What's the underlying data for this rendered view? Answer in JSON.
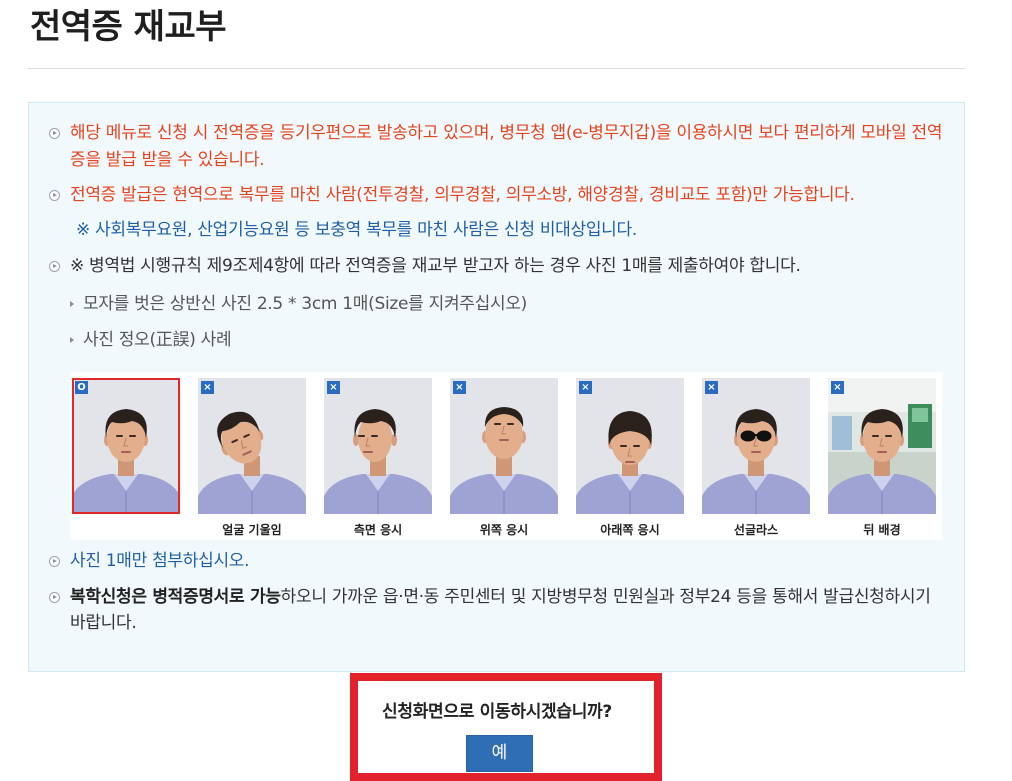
{
  "page": {
    "title": "전역증 재교부"
  },
  "notice": {
    "mobile_notice": "해당 메뉴로 신청 시 전역증을 등기우편으로 발송하고 있으며, 병무청 앱(e-병무지갑)을 이용하시면 보다 편리하게 모바일 전역증을 발급 받을 수 있습니다.",
    "eligibility": "전역증 발급은 현역으로 복무를 마친 사람(전투경찰, 의무경찰, 의무소방, 해양경찰, 경비교도 포함)만 가능합니다.",
    "ineligible_note": "※ 사회복무요원, 산업기능요원 등 보충역 복무를 마친 사람은 신청 비대상입니다.",
    "photo_requirement": "※ 병역법 시행규칙 제9조제4항에 따라 전역증을 재교부 받고자 하는 경우 사진 1매를 제출하여야 합니다.",
    "photo_specs": [
      "모자를 벗은 상반신 사진 2.5 * 3cm 1매(Size를 지켜주십시오)",
      "사진 정오(正誤) 사례"
    ],
    "attach_note": "사진 1매만 첨부하십시오.",
    "readmission_bold": "복학신청은 병적증명서로 가능",
    "readmission_rest": "하오니 가까운 읍·면·동 주민센터 및 지방병무청 민원실과 정부24 등을 통해서 발급신청하시기 바랍니다."
  },
  "photo_examples": [
    {
      "badge": "O",
      "label": ""
    },
    {
      "badge": "×",
      "label": "얼굴 기울임"
    },
    {
      "badge": "×",
      "label": "측면 응시"
    },
    {
      "badge": "×",
      "label": "위쪽 응시"
    },
    {
      "badge": "×",
      "label": "아래쪽 응시"
    },
    {
      "badge": "×",
      "label": "선글라스"
    },
    {
      "badge": "×",
      "label": "뒤 배경"
    }
  ],
  "dialog": {
    "message": "신청화면으로 이동하시겠습니까?",
    "confirm_label": "예"
  },
  "icons": {
    "bullet": "circle-arrow-icon",
    "sub_bullet": "chevron-right-icon",
    "correct_badge": "correct-badge-icon",
    "incorrect_badge": "incorrect-badge-icon"
  },
  "colors": {
    "warning_text": "#e5441e",
    "info_text": "#1e5fa8",
    "panel_background": "#f2f9fc",
    "panel_border": "#d3e7f0",
    "button_blue": "#2f6db5",
    "highlight_frame": "#e3232b",
    "correct_photo_border": "#e02a2a"
  }
}
